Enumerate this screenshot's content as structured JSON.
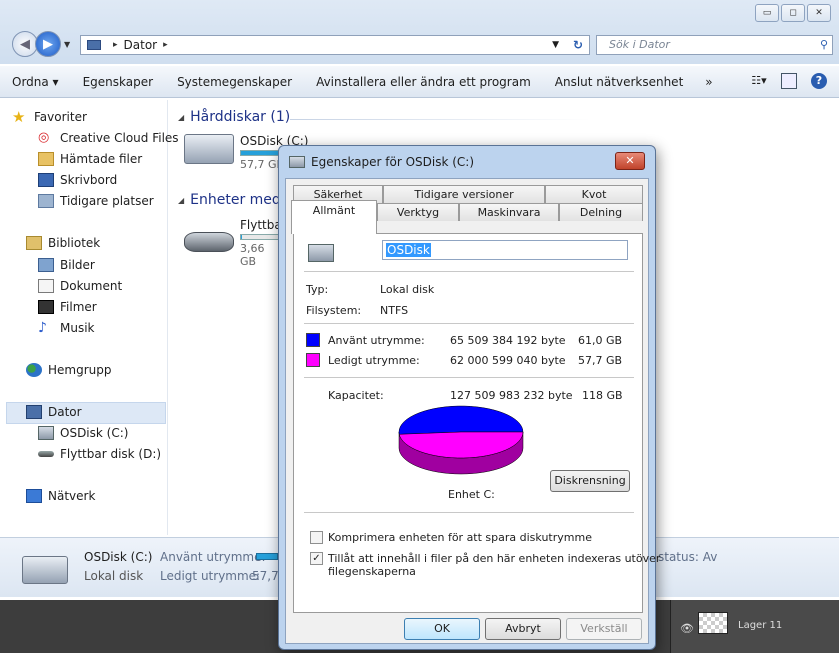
{
  "window": {
    "controls": [
      "▭",
      "◻",
      "✕"
    ]
  },
  "address": {
    "root": "Dator",
    "separator": "▸"
  },
  "search": {
    "placeholder": "Sök i Dator"
  },
  "toolbar": {
    "items": [
      "Ordna ▾",
      "Egenskaper",
      "Systemegenskaper",
      "Avinstallera eller ändra ett program",
      "Anslut nätverksenhet",
      "»"
    ]
  },
  "nav": {
    "favorites": "Favoriter",
    "fav_items": [
      "Creative Cloud Files",
      "Hämtade filer",
      "Skrivbord",
      "Tidigare platser"
    ],
    "library": "Bibliotek",
    "lib_items": [
      "Bilder",
      "Dokument",
      "Filmer",
      "Musik"
    ],
    "homegroup": "Hemgrupp",
    "computer": "Dator",
    "comp_items": [
      "OSDisk (C:)",
      "Flyttbar disk (D:)"
    ],
    "network": "Nätverk"
  },
  "content": {
    "group_hdd": "Hårddiskar (1)",
    "group_removable": "Enheter med",
    "drive_c": {
      "name": "OSDisk (C:)",
      "size": "57,7 GB",
      "used_fraction": 0.51
    },
    "drive_d": {
      "name": "Flyttbar",
      "size": "3,66 GB",
      "used_fraction": 0.02
    }
  },
  "details": {
    "name": "OSDisk (C:)",
    "type": "Lokal disk",
    "used_label": "Använt utrymme:",
    "free_label": "Ledigt utrymme:",
    "free_value": "57,7",
    "status": "status: Av"
  },
  "layers": {
    "name": "Lager 11"
  },
  "dialog": {
    "title": "Egenskaper för OSDisk (C:)",
    "tabs_back": [
      "Säkerhet",
      "Tidigare versioner",
      "Kvot"
    ],
    "tabs_front": [
      "Allmänt",
      "Verktyg",
      "Maskinvara",
      "Delning"
    ],
    "volume_name": "OSDisk",
    "type_label": "Typ:",
    "type_value": "Lokal disk",
    "fs_label": "Filsystem:",
    "fs_value": "NTFS",
    "used_label": "Använt utrymme:",
    "used_bytes": "65 509 384 192 byte",
    "used_gb": "61,0 GB",
    "free_label": "Ledigt utrymme:",
    "free_bytes": "62 000 599 040 byte",
    "free_gb": "57,7 GB",
    "cap_label": "Kapacitet:",
    "cap_bytes": "127 509 983 232 byte",
    "cap_gb": "118 GB",
    "drive_label": "Enhet C:",
    "cleanup_button": "Diskrensning",
    "compress_label": "Komprimera enheten för att spara diskutrymme",
    "compress_checked": false,
    "index_label_1": "Tillåt att innehåll i filer på den här enheten indexeras utöver",
    "index_label_2": "filegenskaperna",
    "index_checked": true,
    "ok": "OK",
    "cancel": "Avbryt",
    "apply": "Verkställ",
    "used_color": "#0000ff",
    "free_color": "#ff00ff",
    "used_fraction": 0.514
  }
}
